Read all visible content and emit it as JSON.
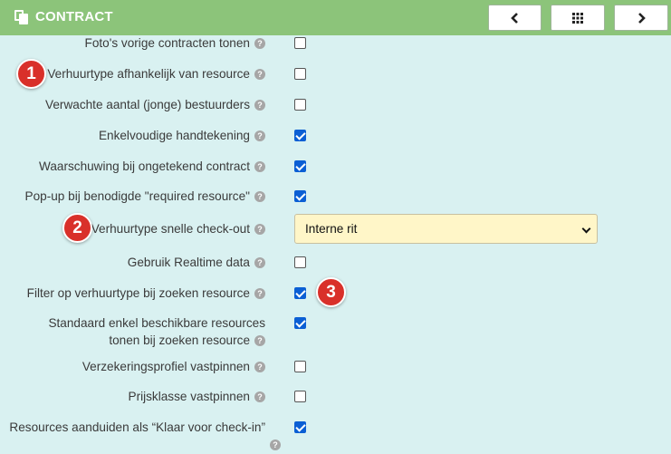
{
  "header": {
    "title": "CONTRACT",
    "prev_label": "<",
    "grid_label": "⁝⁝⁝",
    "next_label": ">"
  },
  "settings": [
    {
      "label": "Foto's vorige contracten tonen",
      "checked": false
    },
    {
      "label": "Verhuurtype afhankelijk van resource",
      "checked": false
    },
    {
      "label": "Verwachte aantal (jonge) bestuurders",
      "checked": false
    },
    {
      "label": "Enkelvoudige handtekening",
      "checked": true
    },
    {
      "label": "Waarschuwing bij ongetekend contract",
      "checked": true
    },
    {
      "label": "Pop-up bij benodigde \"required resource\"",
      "checked": true
    },
    {
      "label": "Verhuurtype snelle check-out",
      "value": "Interne rit"
    },
    {
      "label": "Gebruik Realtime data",
      "checked": false
    },
    {
      "label": "Filter op verhuurtype bij zoeken resource",
      "checked": true
    },
    {
      "label_line1": "Standaard enkel beschikbare resources",
      "label_line2": "tonen bij zoeken resource",
      "checked": true
    },
    {
      "label": "Verzekeringsprofiel vastpinnen",
      "checked": false
    },
    {
      "label": "Prijsklasse vastpinnen",
      "checked": false
    },
    {
      "label": "Resources aanduiden als “Klaar voor check-in”",
      "checked": true
    }
  ],
  "badges": [
    "1",
    "2",
    "3"
  ],
  "help_glyph": "?",
  "colors": {
    "header": "#8cc47a",
    "background": "#d9f1f1",
    "select_bg": "#fff6c8",
    "badge": "#d9302a",
    "checkbox": "#0b5fd4"
  }
}
